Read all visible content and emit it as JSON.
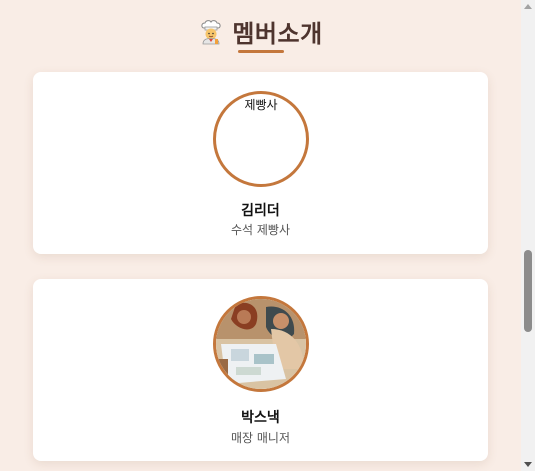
{
  "section": {
    "title": "멤버소개",
    "icon": "chef-icon"
  },
  "members": [
    {
      "name": "김리더",
      "role": "수석 제빵사",
      "avatar_alt": "제빵사",
      "avatar_loaded": false
    },
    {
      "name": "박스낵",
      "role": "매장 매니저",
      "avatar_alt": "매장 매니저",
      "avatar_loaded": true
    }
  ],
  "colors": {
    "background": "#f9ede6",
    "accent": "#c4773c",
    "title": "#4e342e"
  }
}
